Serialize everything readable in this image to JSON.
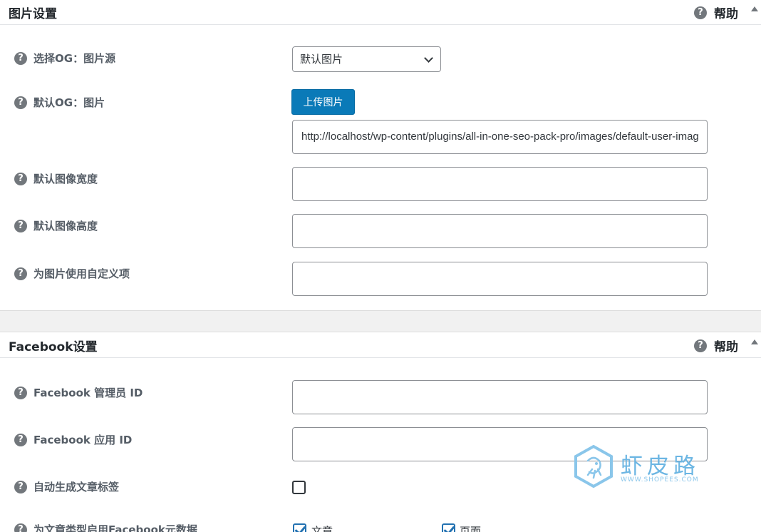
{
  "image_settings": {
    "title": "图片设置",
    "help": "帮助",
    "og_source": {
      "label": "选择OG：图片源",
      "selected": "默认图片"
    },
    "default_og_image": {
      "label": "默认OG：图片",
      "upload_button": "上传图片",
      "url": "http://localhost/wp-content/plugins/all-in-one-seo-pack-pro/images/default-user-image.png"
    },
    "default_width": {
      "label": "默认图像宽度",
      "value": ""
    },
    "default_height": {
      "label": "默认图像高度",
      "value": ""
    },
    "custom_field": {
      "label": "为图片使用自定义项",
      "value": ""
    }
  },
  "facebook_settings": {
    "title": "Facebook设置",
    "help": "帮助",
    "admin_id": {
      "label": "Facebook 管理员 ID",
      "value": ""
    },
    "app_id": {
      "label": "Facebook 应用 ID",
      "value": ""
    },
    "auto_tags": {
      "label": "自动生成文章标签",
      "checked": false
    },
    "meta_post_types": {
      "label": "为文章类型启用Facebook元数据",
      "options": [
        {
          "label": "文章",
          "checked": true
        },
        {
          "label": "页面",
          "checked": true
        }
      ]
    }
  },
  "watermark": {
    "name": "虾皮路",
    "url": "WWW.SHOPEES.COM"
  },
  "icons": {
    "help": "question-circle-icon",
    "toggle": "triangle-up-icon",
    "select": "chevron-down-icon",
    "checkbox": "checkmark-icon"
  }
}
